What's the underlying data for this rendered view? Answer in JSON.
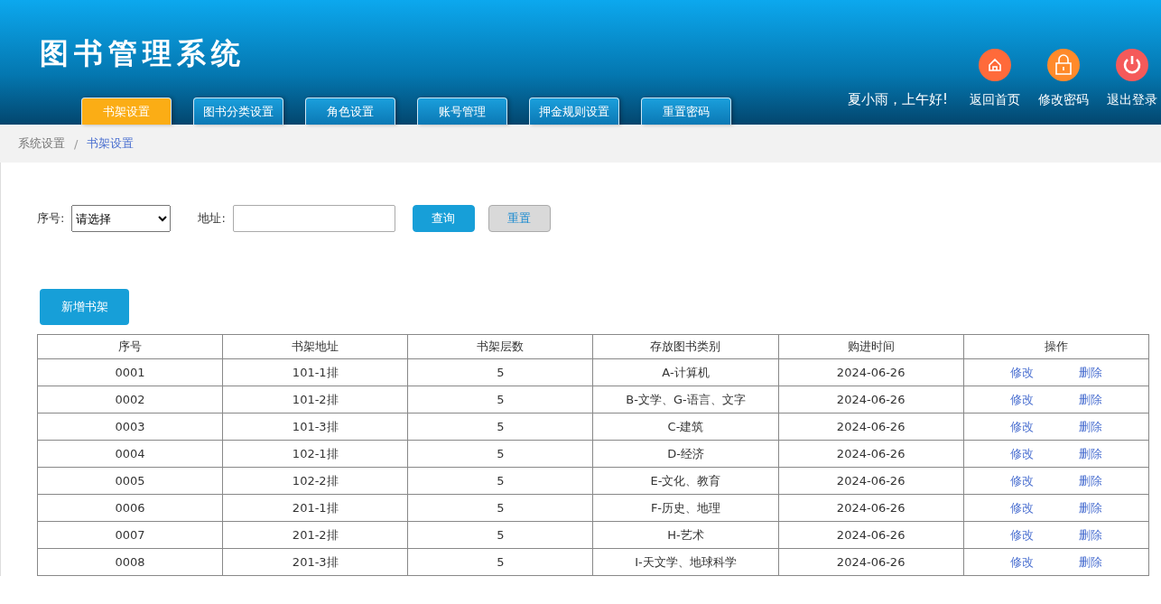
{
  "app_title": "图书管理系统",
  "nav_tabs": [
    {
      "label": "书架设置",
      "selected": true
    },
    {
      "label": "图书分类设置",
      "selected": false
    },
    {
      "label": "角色设置",
      "selected": false
    },
    {
      "label": "账号管理",
      "selected": false
    },
    {
      "label": "押金规则设置",
      "selected": false
    },
    {
      "label": "重置密码",
      "selected": false
    }
  ],
  "greeting": "夏小雨，上午好!",
  "header_actions": [
    {
      "kind": "home",
      "label": "返回首页",
      "color": "#ff6a3a"
    },
    {
      "kind": "lock",
      "label": "修改密码",
      "color": "#ff8a2a"
    },
    {
      "kind": "power",
      "label": "退出登录",
      "color": "#f55a5a"
    }
  ],
  "breadcrumb": {
    "items": [
      "系统设置",
      "书架设置"
    ],
    "separator": "/"
  },
  "filters": {
    "number_label": "序号:",
    "number_select": "请选择",
    "address_label": "地址:",
    "search_button": "查询",
    "reset_button": "重置"
  },
  "add_button": "新增书架",
  "table": {
    "columns": [
      "序号",
      "书架地址",
      "书架层数",
      "存放图书类别",
      "购进时间",
      "操作"
    ],
    "rows": [
      {
        "cells": [
          "0001",
          "101-1排",
          "5",
          "A-计算机",
          "2024-06-26"
        ],
        "actions": [
          "修改",
          "删除"
        ]
      },
      {
        "cells": [
          "0002",
          "101-2排",
          "5",
          "B-文学、G-语言、文字",
          "2024-06-26"
        ],
        "actions": [
          "修改",
          "删除"
        ]
      },
      {
        "cells": [
          "0003",
          "101-3排",
          "5",
          "C-建筑",
          "2024-06-26"
        ],
        "actions": [
          "修改",
          "删除"
        ]
      },
      {
        "cells": [
          "0004",
          "102-1排",
          "5",
          "D-经济",
          "2024-06-26"
        ],
        "actions": [
          "修改",
          "删除"
        ]
      },
      {
        "cells": [
          "0005",
          "102-2排",
          "5",
          "E-文化、教育",
          "2024-06-26"
        ],
        "actions": [
          "修改",
          "删除"
        ]
      },
      {
        "cells": [
          "0006",
          "201-1排",
          "5",
          "F-历史、地理",
          "2024-06-26"
        ],
        "actions": [
          "修改",
          "删除"
        ]
      },
      {
        "cells": [
          "0007",
          "201-2排",
          "5",
          "H-艺术",
          "2024-06-26"
        ],
        "actions": [
          "修改",
          "删除"
        ]
      },
      {
        "cells": [
          "0008",
          "201-3排",
          "5",
          "I-天文学、地球科学",
          "2024-06-26"
        ],
        "actions": [
          "修改",
          "删除"
        ]
      }
    ]
  }
}
